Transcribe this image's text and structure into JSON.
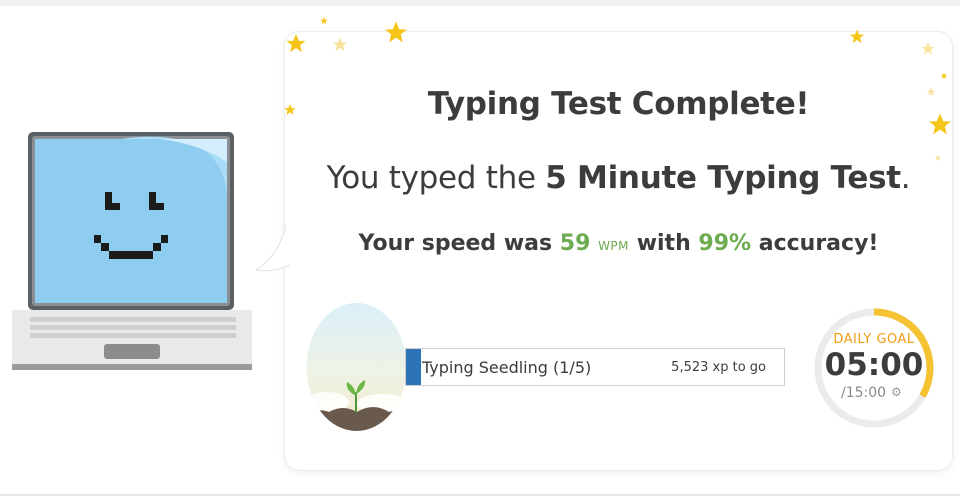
{
  "result": {
    "title": "Typing Test Complete!",
    "subtitle_prefix": "You typed the ",
    "test_name": "5 Minute Typing Test",
    "subtitle_suffix": ".",
    "speed_prefix": "Your speed was ",
    "wpm_value": "59",
    "wpm_unit": "WPM",
    "speed_middle": " with ",
    "accuracy": "99%",
    "speed_suffix": " accuracy!"
  },
  "level": {
    "name": "Typing Seedling (1/5)",
    "xp_to_go": "5,523 xp to go",
    "progress_fraction": 0.04
  },
  "daily_goal": {
    "label": "DAILY GOAL",
    "time": "05:00",
    "target": "/15:00",
    "progress_fraction": 0.3333
  },
  "colors": {
    "accent_green": "#6cab4f",
    "progress_blue": "#2e73b8",
    "goal_orange": "#f39c12",
    "goal_ring": "#f5c232",
    "star_gold": "#f5c518",
    "screen_blue": "#8fcdf0"
  },
  "icons": {
    "mascot": "laptop-smiley-icon",
    "avatar": "seedling-icon",
    "settings": "gear-icon",
    "decoration": "star-icon"
  }
}
